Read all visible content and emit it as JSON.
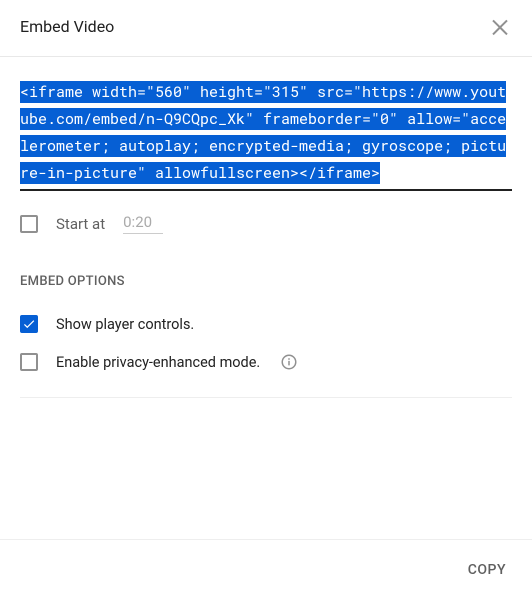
{
  "header": {
    "title": "Embed Video"
  },
  "embed": {
    "code": "<iframe width=\"560\" height=\"315\" src=\"https://www.youtube.com/embed/n-Q9CQpc_Xk\" frameborder=\"0\" allow=\"accelerometer; autoplay; encrypted-media; gyroscope; picture-in-picture\" allowfullscreen></iframe>"
  },
  "startAt": {
    "label": "Start at",
    "value": "0:20",
    "checked": false
  },
  "optionsTitle": "EMBED OPTIONS",
  "options": {
    "showControls": {
      "label": "Show player controls.",
      "checked": true
    },
    "privacy": {
      "label": "Enable privacy-enhanced mode.",
      "checked": false
    }
  },
  "footer": {
    "copy": "COPY"
  }
}
